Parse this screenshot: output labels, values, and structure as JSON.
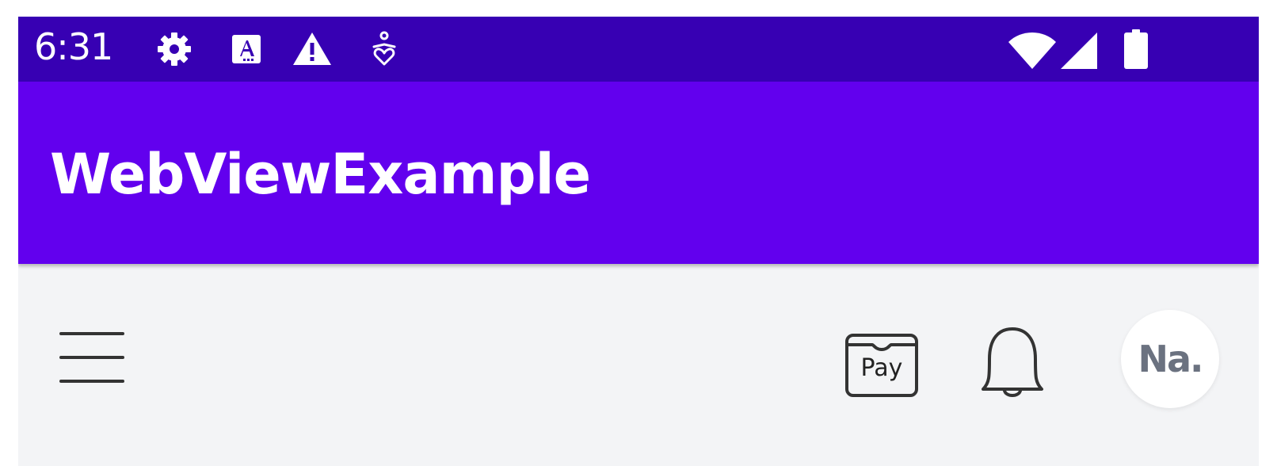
{
  "status_bar": {
    "time": "6:31",
    "left_icons": [
      "settings-gear-icon",
      "accessibility-a-icon",
      "warning-icon",
      "accessibility-heart-icon"
    ],
    "right_icons": [
      "wifi-icon",
      "cellular-signal-icon",
      "battery-icon"
    ]
  },
  "app_bar": {
    "title": "WebViewExample"
  },
  "web_header": {
    "menu_icon": "hamburger-menu-icon",
    "pay_label": "Pay",
    "bell_icon": "notification-bell-icon",
    "avatar_initials": "Na."
  },
  "colors": {
    "status_bar": "#3700b3",
    "app_bar": "#6200ee",
    "content_bg": "#f3f4f6",
    "icon_stroke": "#333333",
    "avatar_text": "#6b7280"
  }
}
